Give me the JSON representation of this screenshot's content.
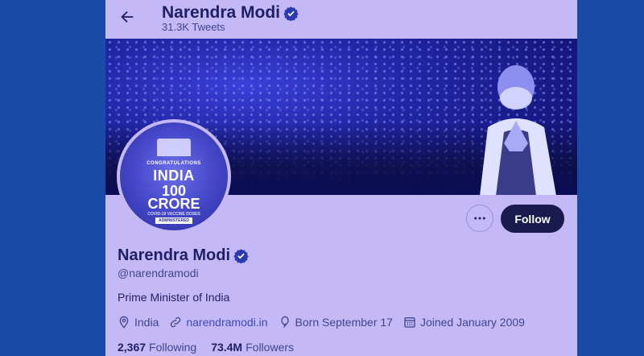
{
  "header": {
    "name": "Narendra Modi",
    "tweet_count": "31.3K Tweets"
  },
  "avatar": {
    "congrats": "CONGRATULATIONS",
    "country": "INDIA",
    "number": "100",
    "unit": "CRORE",
    "small_text": "COVID-19 VACCINE DOSES",
    "admin": "ADMINISTERED"
  },
  "actions": {
    "follow_label": "Follow"
  },
  "profile": {
    "name": "Narendra Modi",
    "handle": "@narendramodi",
    "bio": "Prime Minister of India",
    "location": "India",
    "website": "narendramodi.in",
    "birthday": "Born September 17",
    "joined": "Joined January 2009"
  },
  "stats": {
    "following_count": "2,367",
    "following_label": "Following",
    "followers_count": "73.4M",
    "followers_label": "Followers"
  },
  "icons": [
    "back-arrow-icon",
    "verified-badge-icon",
    "more-icon",
    "location-icon",
    "link-icon",
    "balloon-icon",
    "calendar-icon"
  ],
  "colors": {
    "background": "#1a4ba8",
    "panel": "#c5b8f7",
    "text_dark": "#1e1f66",
    "follow_button": "#1a1a4e",
    "verified": "#2a3bb0"
  }
}
